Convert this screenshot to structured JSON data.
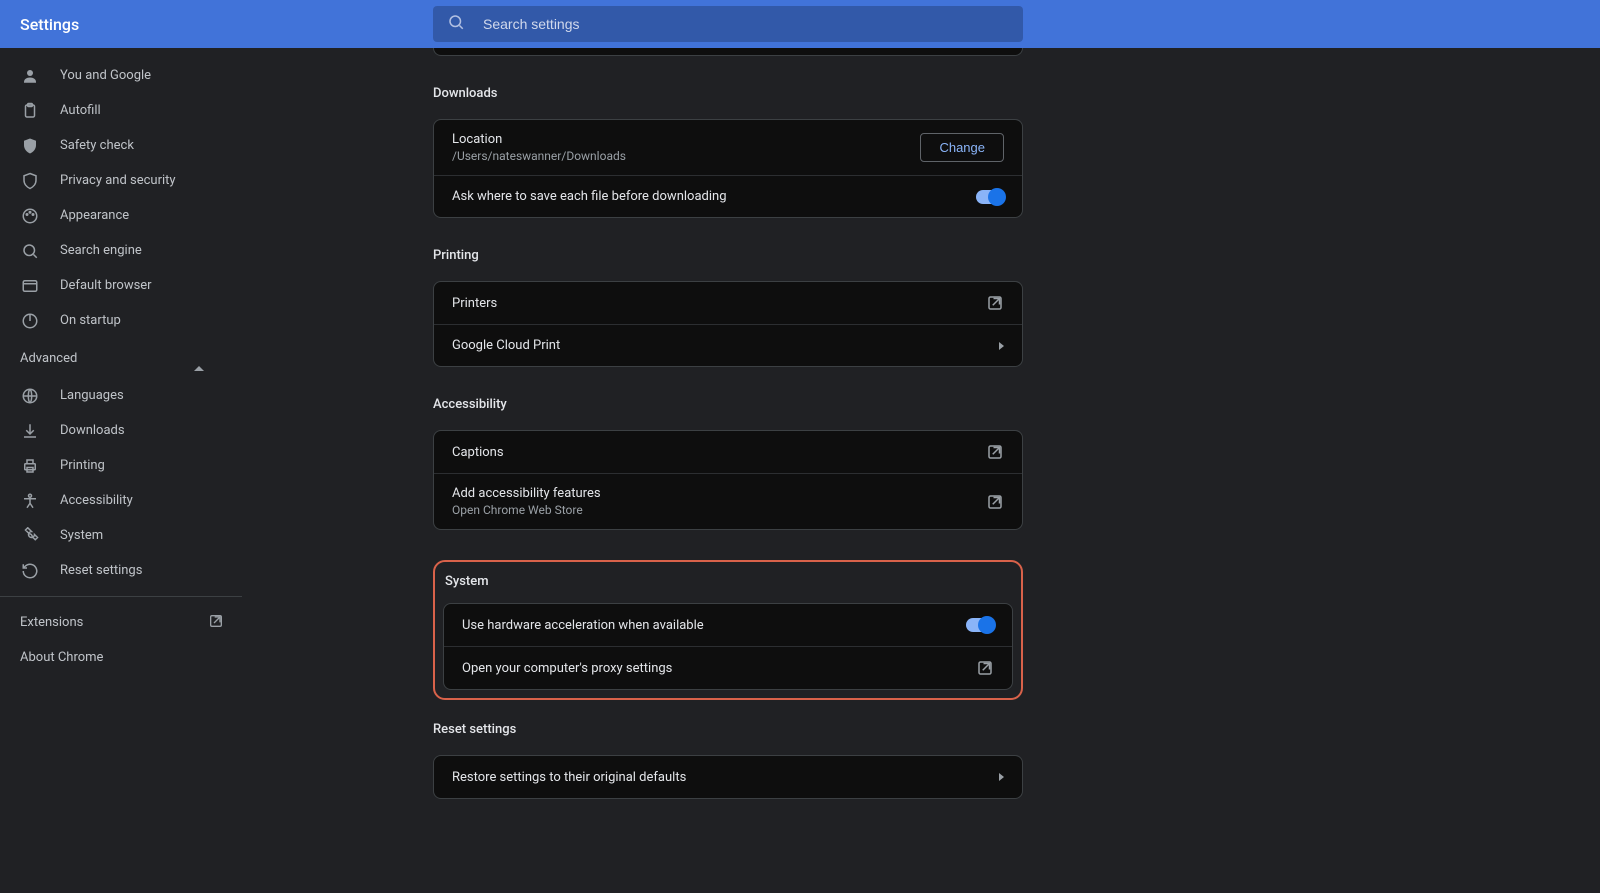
{
  "header": {
    "title": "Settings"
  },
  "search": {
    "placeholder": "Search settings"
  },
  "sidebar": {
    "items": [
      {
        "label": "You and Google"
      },
      {
        "label": "Autofill"
      },
      {
        "label": "Safety check"
      },
      {
        "label": "Privacy and security"
      },
      {
        "label": "Appearance"
      },
      {
        "label": "Search engine"
      },
      {
        "label": "Default browser"
      },
      {
        "label": "On startup"
      }
    ],
    "advanced_label": "Advanced",
    "advanced_items": [
      {
        "label": "Languages"
      },
      {
        "label": "Downloads"
      },
      {
        "label": "Printing"
      },
      {
        "label": "Accessibility"
      },
      {
        "label": "System"
      },
      {
        "label": "Reset settings"
      }
    ],
    "extensions_label": "Extensions",
    "about_label": "About Chrome"
  },
  "sections": {
    "downloads": {
      "title": "Downloads",
      "location_label": "Location",
      "location_value": "/Users/nateswanner/Downloads",
      "change_label": "Change",
      "ask_label": "Ask where to save each file before downloading"
    },
    "printing": {
      "title": "Printing",
      "printers_label": "Printers",
      "gcp_label": "Google Cloud Print"
    },
    "accessibility": {
      "title": "Accessibility",
      "captions_label": "Captions",
      "add_label": "Add accessibility features",
      "add_sub": "Open Chrome Web Store"
    },
    "system": {
      "title": "System",
      "hw_label": "Use hardware acceleration when available",
      "proxy_label": "Open your computer's proxy settings"
    },
    "reset": {
      "title": "Reset settings",
      "restore_label": "Restore settings to their original defaults"
    }
  }
}
